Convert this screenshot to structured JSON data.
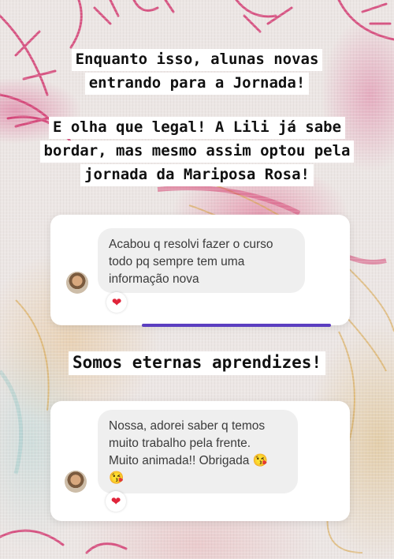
{
  "captions": {
    "intro_line1": "Enquanto isso, alunas novas",
    "intro_line2": "entrando para a Jornada!",
    "story_line1": "E olha que legal! A Lili já sabe",
    "story_line2": "bordar, mas mesmo assim optou pela",
    "story_line3": "jornada da Mariposa Rosa!",
    "middle": "Somos eternas aprendizes!"
  },
  "messages": [
    {
      "line1": "Acabou q resolvi fazer o curso",
      "line2": "todo pq sempre tem uma",
      "line3": "informação nova",
      "reaction": "❤"
    },
    {
      "line1": "Nossa, adorei saber q temos",
      "line2": "muito trabalho pela frente.",
      "line3": "Muito animada!! Obrigada 😘",
      "line4": "😘",
      "reaction": "❤"
    }
  ],
  "colors": {
    "reaction_heart": "#e0243a",
    "accent_bar": "#5b3ec0",
    "bubble": "#efefef"
  }
}
